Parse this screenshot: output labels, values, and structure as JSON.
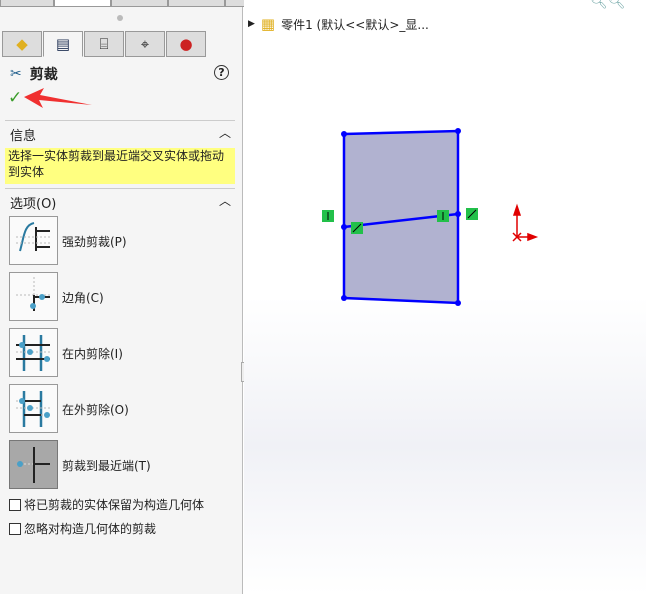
{
  "feature": {
    "title": "剪裁",
    "help": "?",
    "ok": "✓"
  },
  "info": {
    "header": "信息",
    "text": "选择一实体剪裁到最近端交叉实体或拖动到实体"
  },
  "options": {
    "header": "选项(O)",
    "items": [
      {
        "label": "强劲剪裁(P)",
        "selected": false
      },
      {
        "label": "边角(C)",
        "selected": false
      },
      {
        "label": "在内剪除(I)",
        "selected": false
      },
      {
        "label": "在外剪除(O)",
        "selected": false
      },
      {
        "label": "剪裁到最近端(T)",
        "selected": true
      }
    ],
    "checkboxes": [
      {
        "label": "将已剪裁的实体保留为构造几何体",
        "checked": false
      },
      {
        "label": "忽略对构造几何体的剪裁",
        "checked": false
      }
    ]
  },
  "tree": {
    "label": "零件1 (默认<<默认>_显..."
  },
  "colors": {
    "sketch": "#0000ff",
    "fill": "#a9aacb",
    "relation": "#22c04a",
    "origin": "#e00000",
    "info_bg": "#ffff80"
  }
}
